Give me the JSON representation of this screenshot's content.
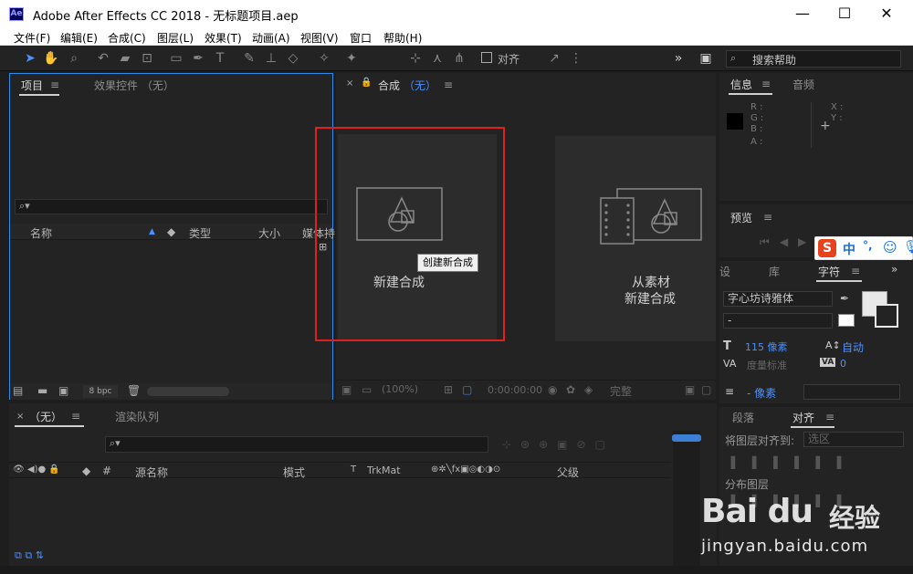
{
  "window": {
    "app_icon": "Ae",
    "title": "Adobe After Effects CC 2018 - 无标题项目.aep",
    "minimize": "—",
    "maximize": "☐",
    "close": "✕"
  },
  "menu": [
    "文件(F)",
    "编辑(E)",
    "合成(C)",
    "图层(L)",
    "效果(T)",
    "动画(A)",
    "视图(V)",
    "窗口",
    "帮助(H)"
  ],
  "toolbar": {
    "snap_label": "对齐",
    "search_help": "搜索帮助"
  },
  "project_panel": {
    "tab_project": "项目",
    "tab_effects": "效果控件 （无）",
    "col_name": "名称",
    "col_type": "类型",
    "col_size": "大小",
    "col_media": "媒体持",
    "bpc": "8 bpc"
  },
  "comp_panel": {
    "tab_label": "合成",
    "tab_value": "（无）",
    "card_new": "新建合成",
    "card_footage_line1": "从素材",
    "card_footage_line2": "新建合成",
    "tooltip": "创建新合成",
    "zoom": "(100%)",
    "timecode": "0:00:00:00",
    "quality": "完整"
  },
  "info_panel": {
    "tab_info": "信息",
    "tab_audio": "音频",
    "r": "R :",
    "g": "G :",
    "b": "B :",
    "a": "A :",
    "x": "X :",
    "y": "Y :"
  },
  "preview_panel": {
    "tab_preview": "预览"
  },
  "char_panel": {
    "tab_left": "设",
    "tab_lib": "库",
    "tab_char": "字符",
    "font": "字心坊诗雅体",
    "style": "-",
    "size": "115 像素",
    "leading": "自动",
    "kerning": "度量标准",
    "tracking": "0",
    "indent": "- 像素"
  },
  "align_panel": {
    "tab_para": "段落",
    "tab_align": "对齐",
    "align_to_label": "将图层对齐到:",
    "align_to_value": "选区",
    "distribute_label": "分布图层"
  },
  "timeline": {
    "tab_comp": "（无）",
    "tab_render": "渲染队列",
    "col_hash": "#",
    "col_source": "源名称",
    "col_mode": "模式",
    "col_t": "T",
    "col_trkmat": "TrkMat",
    "col_parent": "父级"
  },
  "ime": {
    "logo": "S",
    "chinese": "中",
    "punct": "°,",
    "emoji": "☺"
  },
  "watermark": {
    "brand": "Bai du",
    "jingyan": "经验",
    "url": "jingyan.baidu.com"
  },
  "colors": {
    "accent": "#2d8ceb",
    "highlight_box": "#e02020",
    "panel_bg": "#232323"
  }
}
